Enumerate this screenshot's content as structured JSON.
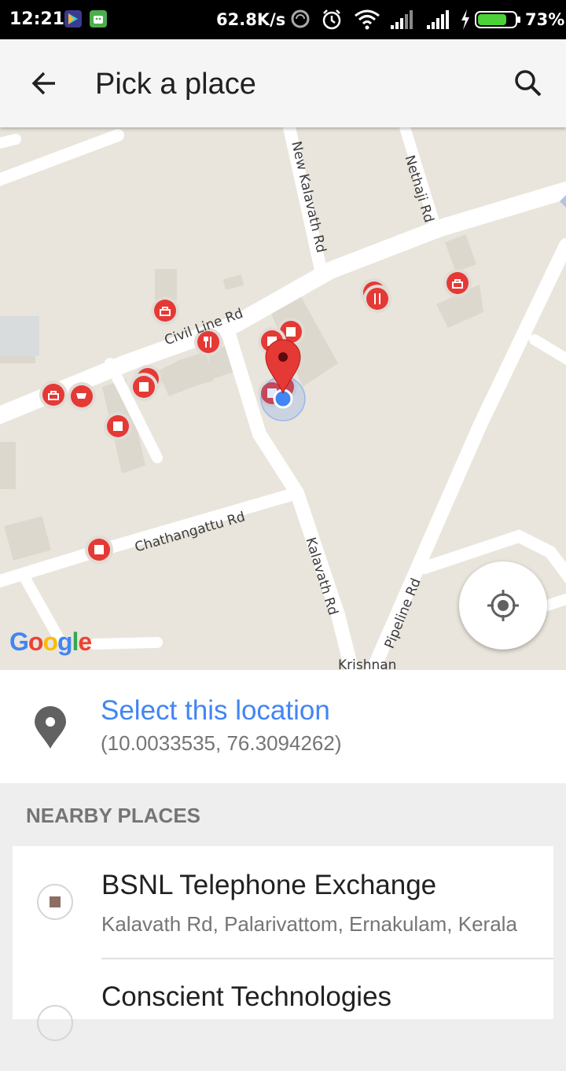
{
  "status_bar": {
    "time": "12:21",
    "net_speed": "62.8K/s",
    "battery_percent": "73%",
    "battery_color": "#4cd137",
    "icons": [
      "app-icon",
      "android-icon",
      "sync-icon",
      "alarm-icon",
      "wifi-icon",
      "signal-icon",
      "signal-icon",
      "charging-icon",
      "battery-icon"
    ]
  },
  "app_bar": {
    "title": "Pick a place",
    "back_icon": "arrow-left-icon",
    "search_icon": "search-icon"
  },
  "map": {
    "road_labels": [
      "New Kalavath Rd",
      "Nethaji Rd",
      "Civil Line Rd",
      "Chathangattu Rd",
      "Kalavath Rd",
      "Pipeline Rd",
      "Krishnan"
    ],
    "attribution": "Google",
    "my_location_icon": "crosshair-icon",
    "marker_color": "#e53935",
    "my_location_dot_color": "#4285f4"
  },
  "selected": {
    "title": "Select this location",
    "coords": "(10.0033535, 76.3094262)",
    "accent": "#4285f4"
  },
  "nearby": {
    "header": "NEARBY PLACES",
    "places": [
      {
        "name": "BSNL Telephone Exchange",
        "address": "Kalavath Rd, Palarivattom, Ernakulam, Kerala"
      },
      {
        "name": "Conscient Technologies",
        "address": ""
      }
    ]
  }
}
